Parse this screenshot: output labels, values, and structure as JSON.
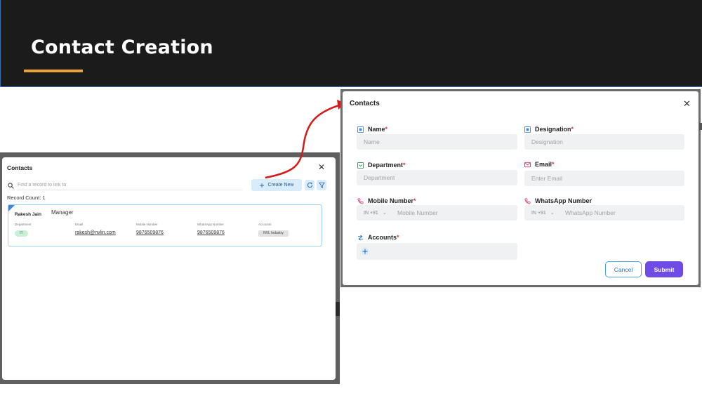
{
  "slide": {
    "title": "Contact Creation",
    "accent_color": "#e9a13b",
    "header_bg": "#1b1b1b"
  },
  "left_modal": {
    "title": "Contacts",
    "close_icon": "close-icon",
    "search": {
      "placeholder": "Find a record to link to",
      "icon": "search-icon"
    },
    "create_button": "Create New",
    "refresh_icon": "refresh-icon",
    "filter_icon": "filter-icon",
    "record_count": "Record Count: 1",
    "record": {
      "name": "Rakesh Jain",
      "designation": "Manager",
      "department_label": "Department",
      "department_value": "IT",
      "email_label": "Email",
      "email_value": "rakesh@nvlin.com",
      "mobile_label": "Mobile Number",
      "mobile_value": "9876509876",
      "whatsapp_label": "WhatsApp Number",
      "whatsapp_value": "9876509876",
      "accounts_label": "Accounts",
      "accounts_value": "NVL Industry"
    }
  },
  "right_modal": {
    "title": "Contacts",
    "close_icon": "close-icon",
    "fields": {
      "name": {
        "label": "Name",
        "required": "*",
        "placeholder": "Name",
        "icon": "id-card-icon"
      },
      "designation": {
        "label": "Designation",
        "required": "*",
        "placeholder": "Designation",
        "icon": "id-card-icon"
      },
      "department": {
        "label": "Department",
        "required": "*",
        "placeholder": "Department",
        "icon": "dropdown-check-icon"
      },
      "email": {
        "label": "Email",
        "required": "*",
        "placeholder": "Enter Email",
        "icon": "mail-icon"
      },
      "mobile": {
        "label": "Mobile Number",
        "required": "*",
        "country_code": "IN +91",
        "placeholder": "Mobile Number",
        "icon": "phone-icon"
      },
      "whatsapp": {
        "label": "WhatsApp Number",
        "country_code": "IN +91",
        "placeholder": "WhatsApp Number",
        "icon": "phone-icon"
      },
      "accounts": {
        "label": "Accounts",
        "required": "*",
        "icon": "accounts-icon",
        "add_icon": "plus-icon"
      }
    },
    "cancel_button": "Cancel",
    "submit_button": "Submit",
    "submit_color": "#6f4be6"
  }
}
